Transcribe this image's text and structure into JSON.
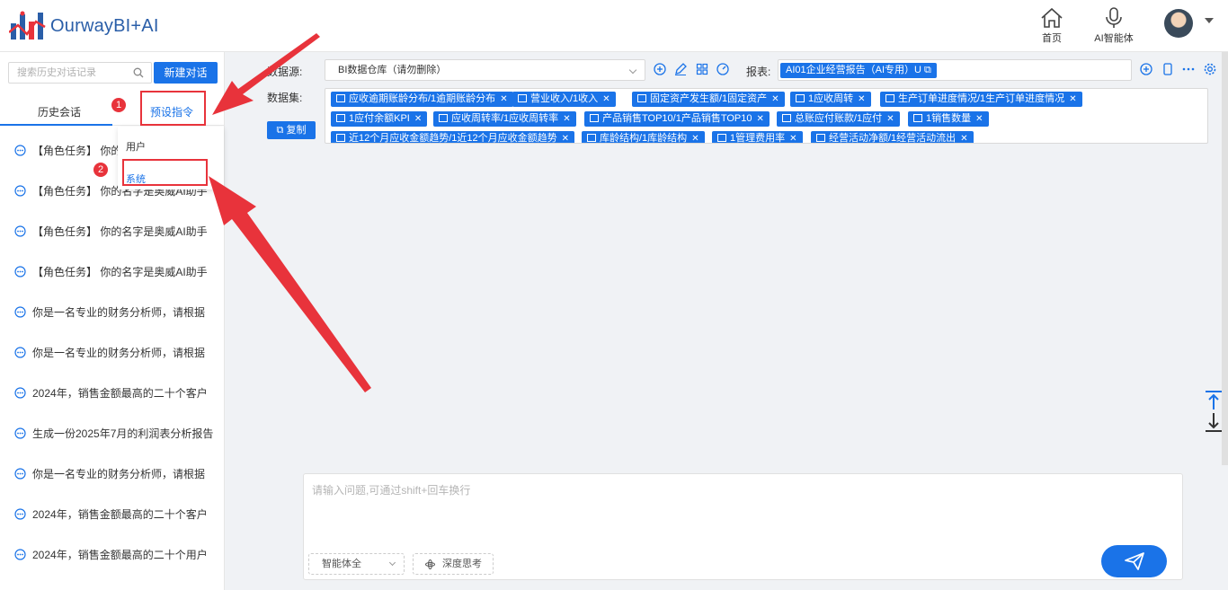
{
  "header": {
    "logo_text": "OurwayBI+AI",
    "home_label": "首页",
    "ai_agent_label": "AI智能体"
  },
  "sidebar": {
    "search_placeholder": "搜索历史对话记录",
    "new_chat_label": "新建对话",
    "tabs": [
      {
        "label": "历史会话"
      },
      {
        "label": "预设指令"
      }
    ],
    "preset_menu": [
      {
        "label": "用户"
      },
      {
        "label": "系统"
      }
    ],
    "history": [
      {
        "text": "【角色任务】 你的名字是奥威AI助手"
      },
      {
        "text": "【角色任务】 你的名字是奥威AI助手"
      },
      {
        "text": "【角色任务】 你的名字是奥威AI助手"
      },
      {
        "text": "【角色任务】 你的名字是奥威AI助手"
      },
      {
        "text": "你是一名专业的财务分析师，请根据"
      },
      {
        "text": "你是一名专业的财务分析师，请根据"
      },
      {
        "text": "2024年，销售金额最高的二十个客户"
      },
      {
        "text": "生成一份2025年7月的利润表分析报告"
      },
      {
        "text": "你是一名专业的财务分析师，请根据"
      },
      {
        "text": "2024年，销售金额最高的二十个客户"
      },
      {
        "text": "2024年，销售金额最高的二十个用户"
      }
    ]
  },
  "config": {
    "datasource_label": "数据源:",
    "datasource_value": "BI数据仓库（请勿删除）",
    "report_label": "报表:",
    "report_tag": "AI01企业经营报告（AI专用）U",
    "dataset_label": "数据集:",
    "copy_label": "复制",
    "dataset_tags": [
      {
        "text": "应收逾期账龄分布/1逾期账龄分布"
      },
      {
        "text": "营业收入/1收入"
      },
      {
        "text": "固定资产发生额/1固定资产"
      },
      {
        "text": "1应收周转"
      },
      {
        "text": "生产订单进度情况/1生产订单进度情况"
      },
      {
        "text": "1应付余额KPI"
      },
      {
        "text": "应收周转率/1应收周转率"
      },
      {
        "text": "产品销售TOP10/1产品销售TOP10"
      },
      {
        "text": "总账应付账款/1应付"
      },
      {
        "text": "1销售数量"
      },
      {
        "text": "近12个月应收金额趋势/1近12个月应收金额趋势"
      },
      {
        "text": "库龄结构/1库龄结构"
      },
      {
        "text": "1管理费用率"
      },
      {
        "text": "经营活动净额/1经营活动流出"
      }
    ]
  },
  "input": {
    "placeholder": "请输入问题,可通过shift+回车换行",
    "agent_select": "智能体全",
    "deep_think_label": "深度思考"
  },
  "annotations": {
    "step1": "1",
    "step2": "2"
  },
  "colors": {
    "accent": "#1a73e8",
    "annotation": "#e8333b"
  }
}
